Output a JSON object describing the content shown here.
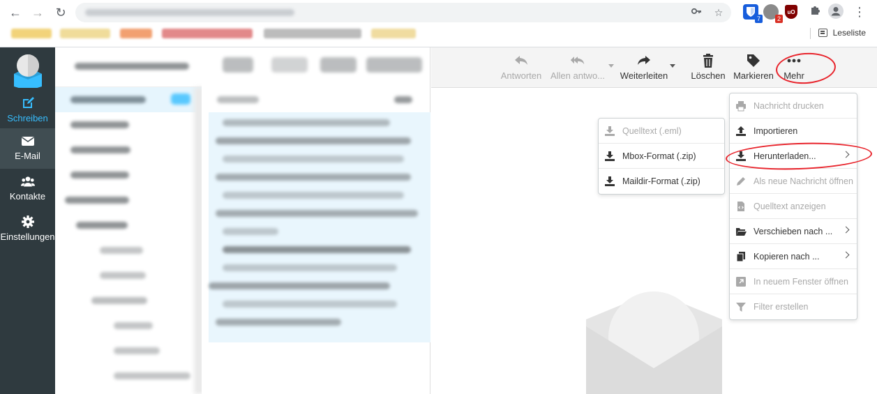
{
  "browser": {
    "bookmarks_bar": {
      "reading_list_label": "Leseliste"
    },
    "extensions": [
      {
        "name": "bitwarden-icon",
        "badge": "7",
        "color": "#175ddc",
        "badge_color": "#175ddc"
      },
      {
        "name": "extension-icon-grey",
        "badge": "2",
        "color": "#8a8a8a",
        "badge_color": "#d93025"
      },
      {
        "name": "ublock-icon",
        "badge": "",
        "color": "#800000",
        "badge_color": "#800000"
      }
    ]
  },
  "appnav": {
    "items": [
      {
        "label": "Schreiben",
        "icon": "compose-icon"
      },
      {
        "label": "E-Mail",
        "icon": "envelope-icon"
      },
      {
        "label": "Kontakte",
        "icon": "contacts-icon"
      },
      {
        "label": "Einstellungen",
        "icon": "gear-icon"
      }
    ]
  },
  "toolbar": {
    "reply": "Antworten",
    "reply_all": "Allen antwo...",
    "forward": "Weiterleiten",
    "delete": "Löschen",
    "mark": "Markieren",
    "more": "Mehr"
  },
  "more_menu": {
    "items": [
      {
        "label": "Nachricht drucken",
        "enabled": false,
        "icon": "print-icon"
      },
      {
        "label": "Importieren",
        "enabled": true,
        "icon": "upload-icon"
      },
      {
        "label": "Herunterladen...",
        "enabled": true,
        "icon": "download-icon",
        "submenu": true
      },
      {
        "label": "Als neue Nachricht öffnen",
        "enabled": false,
        "icon": "pencil-icon"
      },
      {
        "label": "Quelltext anzeigen",
        "enabled": false,
        "icon": "file-code-icon"
      },
      {
        "label": "Verschieben nach ...",
        "enabled": true,
        "icon": "folder-open-icon",
        "submenu": true
      },
      {
        "label": "Kopieren nach ...",
        "enabled": true,
        "icon": "copy-icon",
        "submenu": true
      },
      {
        "label": "In neuem Fenster öffnen",
        "enabled": false,
        "icon": "external-window-icon"
      },
      {
        "label": "Filter erstellen",
        "enabled": false,
        "icon": "filter-icon"
      }
    ]
  },
  "download_submenu": {
    "items": [
      {
        "label": "Quelltext (.eml)",
        "enabled": false
      },
      {
        "label": "Mbox-Format (.zip)",
        "enabled": true
      },
      {
        "label": "Maildir-Format (.zip)",
        "enabled": true
      }
    ]
  },
  "colors": {
    "appnav_bg": "#2f3a3f",
    "appnav_active": "#404d52",
    "accent": "#37beff",
    "annotation": "#e8222a",
    "selection": "#e9f6fd"
  }
}
